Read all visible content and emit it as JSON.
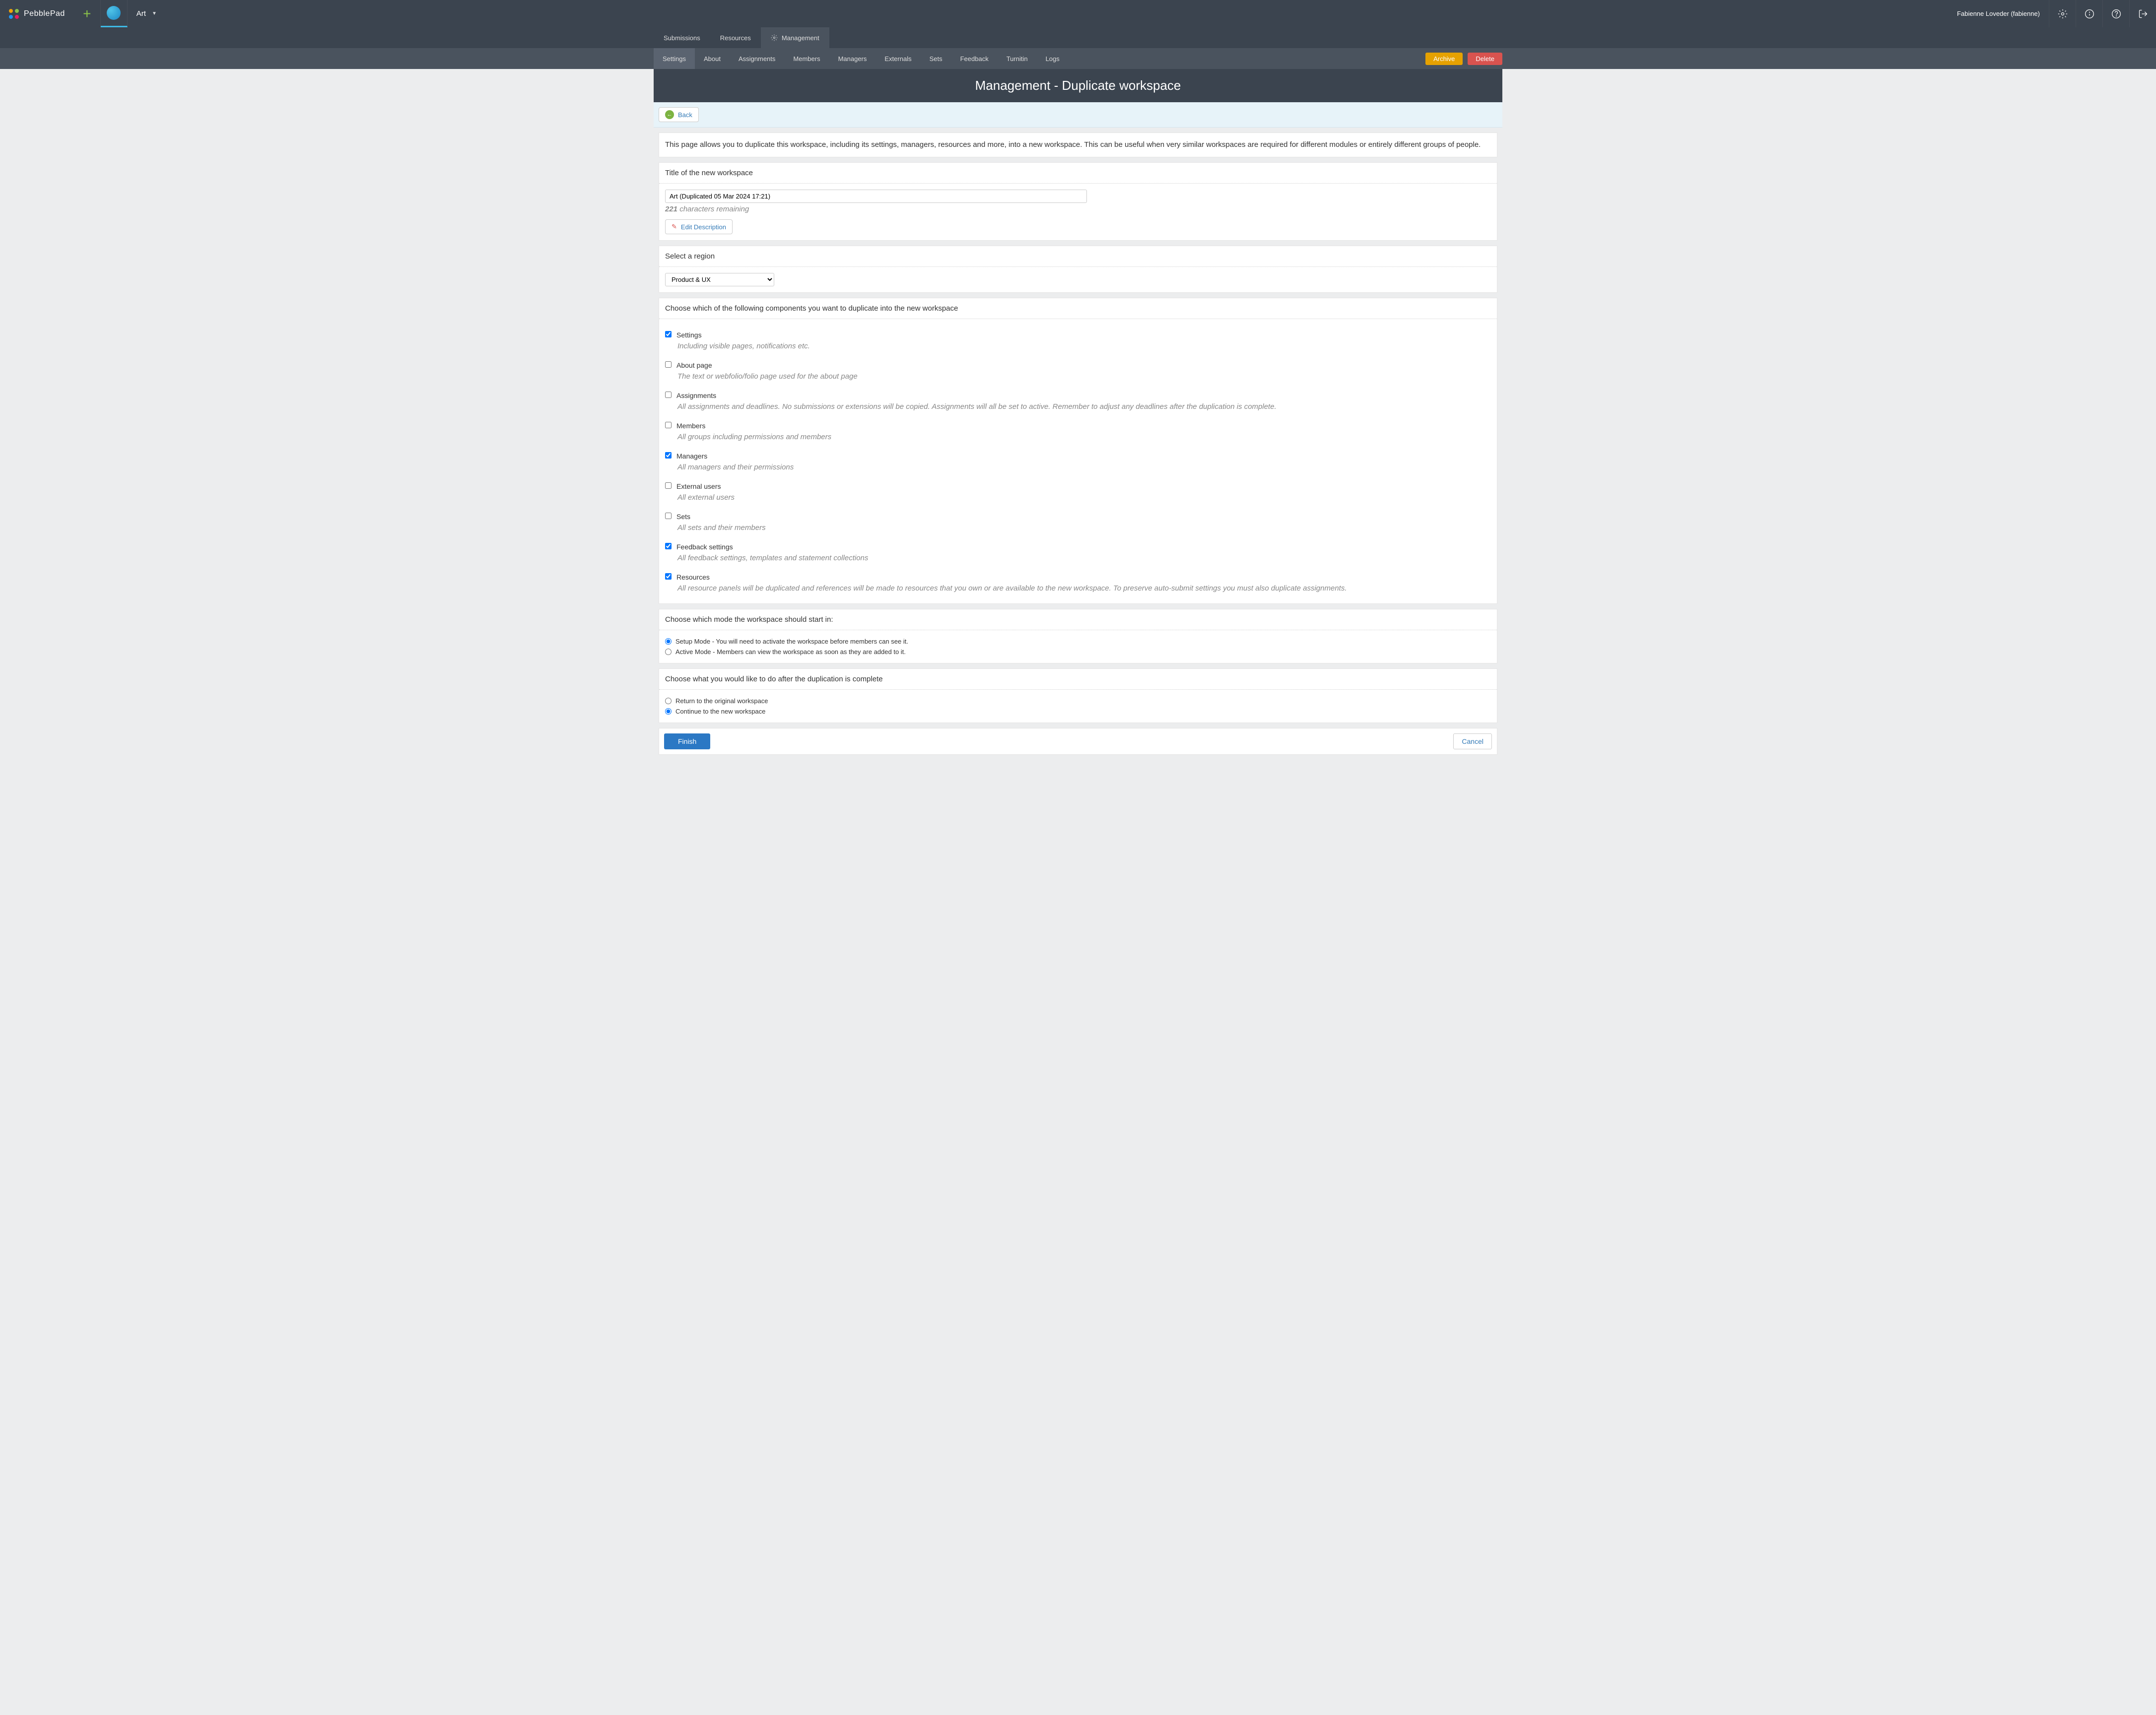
{
  "brand": "PebblePad",
  "workspace_switcher_label": "Art",
  "user_display": "Fabienne Loveder (fabienne)",
  "main_nav": {
    "submissions": "Submissions",
    "resources": "Resources",
    "management": "Management"
  },
  "sec_nav": {
    "settings": "Settings",
    "about": "About",
    "assignments": "Assignments",
    "members": "Members",
    "managers": "Managers",
    "externals": "Externals",
    "sets": "Sets",
    "feedback": "Feedback",
    "turnitin": "Turnitin",
    "logs": "Logs",
    "archive": "Archive",
    "delete": "Delete"
  },
  "page_title": "Management - Duplicate workspace",
  "back_label": "Back",
  "intro_text": "This page allows you to duplicate this workspace, including its settings, managers, resources and more, into a new workspace. This can be useful when very similar workspaces are required for different modules or entirely different groups of people.",
  "title_section": {
    "header": "Title of the new workspace",
    "value": "Art (Duplicated 05 Mar 2024 17:21)",
    "remaining_count": "221",
    "remaining_label": "characters remaining",
    "edit_desc_label": "Edit Description"
  },
  "region_section": {
    "header": "Select a region",
    "selected": "Product & UX"
  },
  "components_section": {
    "header": "Choose which of the following components you want to duplicate into the new workspace",
    "items": [
      {
        "key": "settings",
        "label": "Settings",
        "sub": "Including visible pages, notifications etc.",
        "checked": true
      },
      {
        "key": "about",
        "label": "About page",
        "sub": "The text or webfolio/folio page used for the about page",
        "checked": false
      },
      {
        "key": "assignments",
        "label": "Assignments",
        "sub": "All assignments and deadlines. No submissions or extensions will be copied. Assignments will all be set to active. Remember to adjust any deadlines after the duplication is complete.",
        "checked": false
      },
      {
        "key": "members",
        "label": "Members",
        "sub": "All groups including permissions and members",
        "checked": false
      },
      {
        "key": "managers",
        "label": "Managers",
        "sub": "All managers and their permissions",
        "checked": true
      },
      {
        "key": "external",
        "label": "External users",
        "sub": "All external users",
        "checked": false
      },
      {
        "key": "sets",
        "label": "Sets",
        "sub": "All sets and their members",
        "checked": false
      },
      {
        "key": "feedback",
        "label": "Feedback settings",
        "sub": "All feedback settings, templates and statement collections",
        "checked": true
      },
      {
        "key": "resources",
        "label": "Resources",
        "sub": "All resource panels will be duplicated and references will be made to resources that you own or are available to the new workspace. To preserve auto-submit settings you must also duplicate assignments.",
        "checked": true
      }
    ]
  },
  "mode_section": {
    "header": "Choose which mode the workspace should start in:",
    "setup_label": "Setup Mode - You will need to activate the workspace before members can see it.",
    "active_label": "Active Mode - Members can view the workspace as soon as they are added to it."
  },
  "after_section": {
    "header": "Choose what you would like to do after the duplication is complete",
    "return_label": "Return to the original workspace",
    "continue_label": "Continue to the new workspace"
  },
  "footer": {
    "finish": "Finish",
    "cancel": "Cancel"
  }
}
